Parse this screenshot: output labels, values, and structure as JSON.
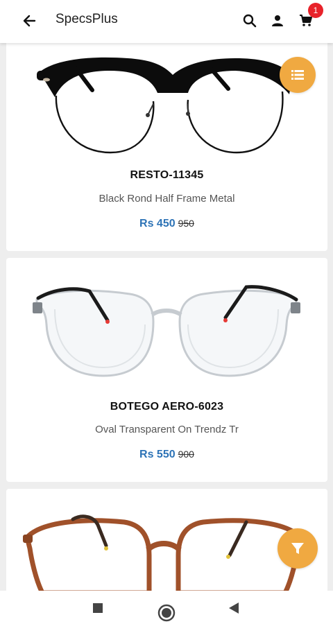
{
  "header": {
    "title": "SpecsPlus",
    "cart_count": "1",
    "icons": [
      "back-arrow-icon",
      "search-icon",
      "account-icon",
      "cart-icon"
    ]
  },
  "products": [
    {
      "name": "RESTO-11345",
      "description": "Black Rond Half Frame Metal",
      "price": "Rs 450",
      "mrp": "950"
    },
    {
      "name": "BOTEGO AERO-6023",
      "description": "Oval Transparent On Trendz Tr",
      "price": "Rs 550",
      "mrp": "900"
    },
    {
      "name": "",
      "description": "",
      "price": "",
      "mrp": ""
    }
  ],
  "fabs": {
    "list_icon": "list-view-icon",
    "filter_icon": "filter-icon"
  },
  "colors": {
    "accent_fab": "#f0a941",
    "price": "#2d73b6",
    "badge": "#e8222a"
  }
}
